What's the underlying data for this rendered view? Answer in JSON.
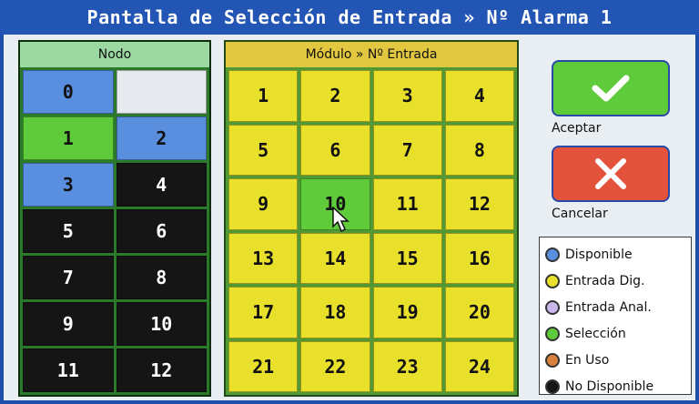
{
  "window": {
    "title": "Pantalla de Selección de Entrada » Nº Alarma 1"
  },
  "colors": {
    "disponible": "#5a8fe0",
    "entrada_dig": "#e9e02c",
    "entrada_anal": "#c9b6ea",
    "seleccion": "#5fcb3a",
    "en_uso": "#d9803f",
    "no_disponible": "#151515",
    "empty": "#e6eaee"
  },
  "node_panel": {
    "header": "Nodo",
    "cells": [
      {
        "label": "0",
        "state": "blue"
      },
      {
        "label": "",
        "state": "white"
      },
      {
        "label": "1",
        "state": "green"
      },
      {
        "label": "2",
        "state": "blue"
      },
      {
        "label": "3",
        "state": "blue"
      },
      {
        "label": "4",
        "state": "black"
      },
      {
        "label": "5",
        "state": "black"
      },
      {
        "label": "6",
        "state": "black"
      },
      {
        "label": "7",
        "state": "black"
      },
      {
        "label": "8",
        "state": "black"
      },
      {
        "label": "9",
        "state": "black"
      },
      {
        "label": "10",
        "state": "black"
      },
      {
        "label": "11",
        "state": "black"
      },
      {
        "label": "12",
        "state": "black"
      }
    ]
  },
  "module_panel": {
    "header": "Módulo » Nº Entrada",
    "cells": [
      {
        "label": "1",
        "state": "yellow"
      },
      {
        "label": "2",
        "state": "yellow"
      },
      {
        "label": "3",
        "state": "yellow"
      },
      {
        "label": "4",
        "state": "yellow"
      },
      {
        "label": "5",
        "state": "yellow"
      },
      {
        "label": "6",
        "state": "yellow"
      },
      {
        "label": "7",
        "state": "yellow"
      },
      {
        "label": "8",
        "state": "yellow"
      },
      {
        "label": "9",
        "state": "yellow"
      },
      {
        "label": "10",
        "state": "green"
      },
      {
        "label": "11",
        "state": "yellow"
      },
      {
        "label": "12",
        "state": "yellow"
      },
      {
        "label": "13",
        "state": "yellow"
      },
      {
        "label": "14",
        "state": "yellow"
      },
      {
        "label": "15",
        "state": "yellow"
      },
      {
        "label": "16",
        "state": "yellow"
      },
      {
        "label": "17",
        "state": "yellow"
      },
      {
        "label": "18",
        "state": "yellow"
      },
      {
        "label": "19",
        "state": "yellow"
      },
      {
        "label": "20",
        "state": "yellow"
      },
      {
        "label": "21",
        "state": "yellow"
      },
      {
        "label": "22",
        "state": "yellow"
      },
      {
        "label": "23",
        "state": "yellow"
      },
      {
        "label": "24",
        "state": "yellow"
      }
    ]
  },
  "actions": {
    "accept_label": "Aceptar",
    "accept_icon": "checkmark-icon",
    "cancel_label": "Cancelar",
    "cancel_icon": "x-icon"
  },
  "legend": {
    "items": [
      {
        "label": "Disponible",
        "color_key": "disponible"
      },
      {
        "label": "Entrada Dig.",
        "color_key": "entrada_dig"
      },
      {
        "label": "Entrada Anal.",
        "color_key": "entrada_anal"
      },
      {
        "label": "Selección",
        "color_key": "seleccion"
      },
      {
        "label": "En Uso",
        "color_key": "en_uso"
      },
      {
        "label": "No Disponible",
        "color_key": "no_disponible"
      }
    ]
  }
}
